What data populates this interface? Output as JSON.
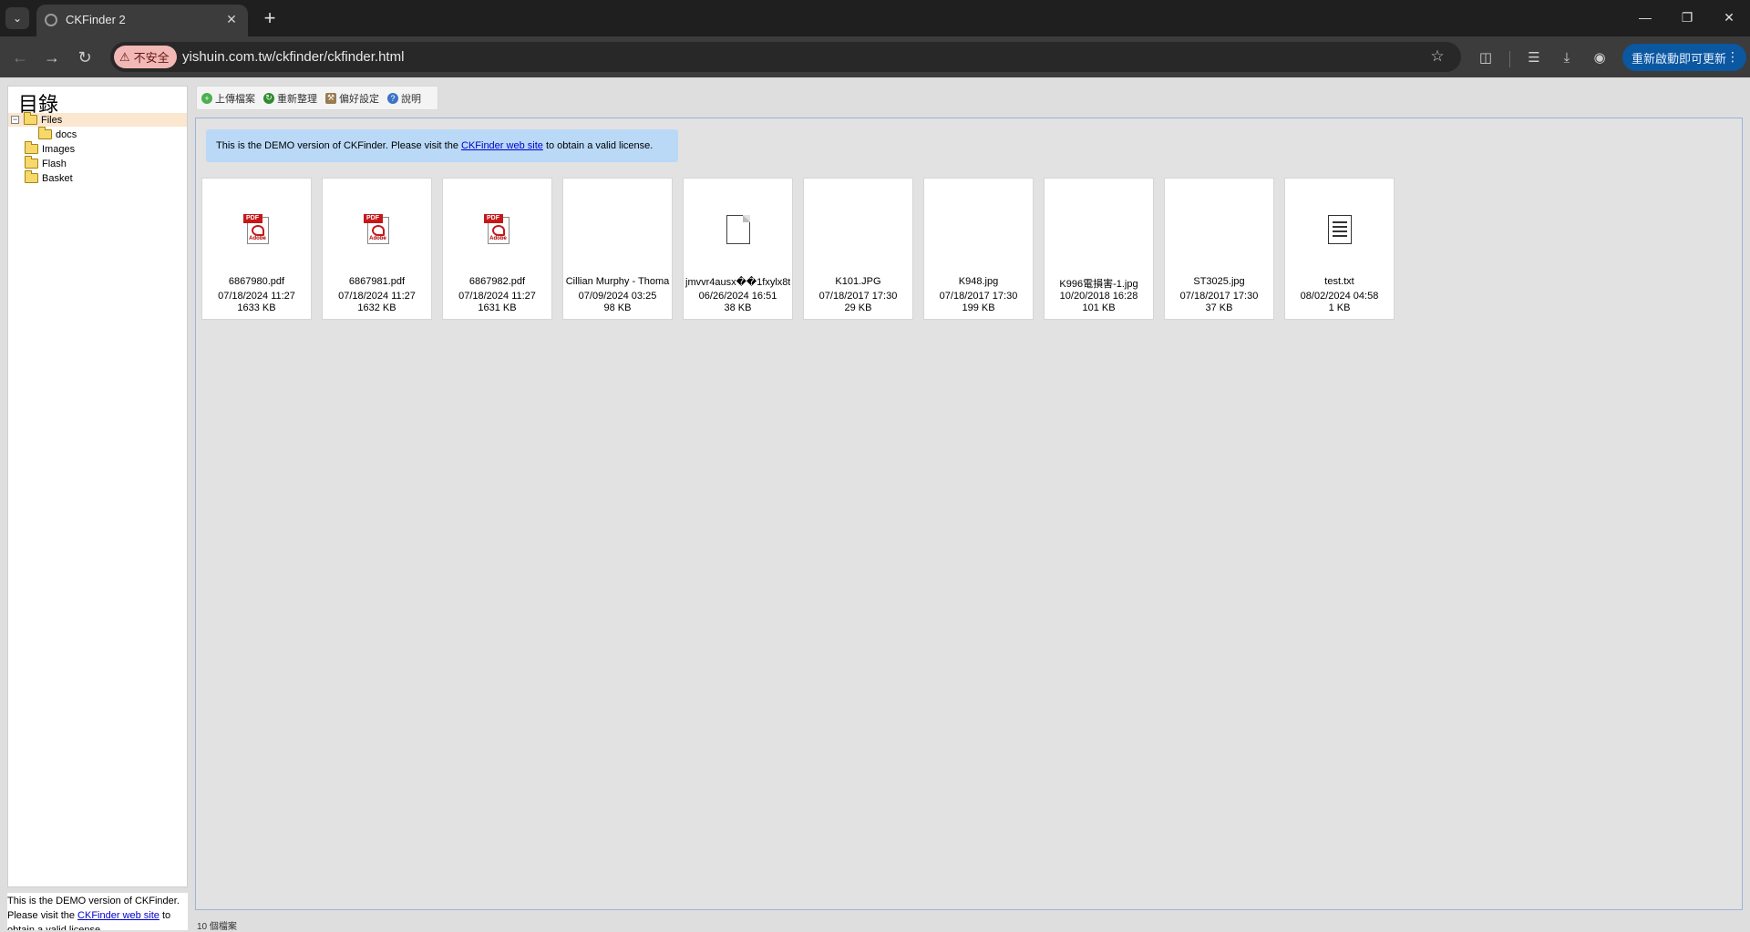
{
  "browser": {
    "tab_title": "CKFinder 2",
    "tab_close": "✕",
    "new_tab": "+",
    "insecure_label": "不安全",
    "url": "yishuin.com.tw/ckfinder/ckfinder.html",
    "update_label": "重新啟動即可更新",
    "update_menu": "⋮"
  },
  "sidebar": {
    "title": "目錄",
    "tree": [
      {
        "label": "Files",
        "level": 0,
        "expanded": true,
        "selected": true
      },
      {
        "label": "docs",
        "level": 1,
        "expanded": false,
        "selected": false
      },
      {
        "label": "Images",
        "level": 0,
        "expanded": false,
        "selected": false
      },
      {
        "label": "Flash",
        "level": 0,
        "expanded": false,
        "selected": false
      },
      {
        "label": "Basket",
        "level": 0,
        "expanded": false,
        "selected": false
      }
    ],
    "footer": {
      "text_before": "This is the DEMO version of CKFinder. Please visit the ",
      "link": "CKFinder web site",
      "text_after": " to obtain a valid license."
    }
  },
  "toolbar": {
    "buttons": [
      {
        "label": "上傳檔案",
        "icon": "upload-icon",
        "color": "#4caf50"
      },
      {
        "label": "重新整理",
        "icon": "refresh-icon",
        "color": "#2e8b2e"
      },
      {
        "label": "偏好設定",
        "icon": "settings-icon",
        "color": "#9a7b4f"
      },
      {
        "label": "說明",
        "icon": "help-icon",
        "color": "#3b73c8"
      }
    ]
  },
  "banner": {
    "text_before": "This is the DEMO version of CKFinder. Please visit the ",
    "link": "CKFinder web site",
    "text_after": " to obtain a valid license.",
    "color": "#b9d9f7"
  },
  "files": [
    {
      "name": "6867980.pdf",
      "date": "07/18/2024 11:27",
      "size": "1633 KB",
      "icon": "pdf"
    },
    {
      "name": "6867981.pdf",
      "date": "07/18/2024 11:27",
      "size": "1632 KB",
      "icon": "pdf"
    },
    {
      "name": "6867982.pdf",
      "date": "07/18/2024 11:27",
      "size": "1631 KB",
      "icon": "pdf"
    },
    {
      "name": "Cillian Murphy - Thoma",
      "date": "07/09/2024 03:25",
      "size": "98 KB",
      "icon": "none"
    },
    {
      "name": "jmvvr4ausx��1fxylx8t",
      "date": "06/26/2024 16:51",
      "size": "38 KB",
      "icon": "blank"
    },
    {
      "name": "K101.JPG",
      "date": "07/18/2017 17:30",
      "size": "29 KB",
      "icon": "none"
    },
    {
      "name": "K948.jpg",
      "date": "07/18/2017 17:30",
      "size": "199 KB",
      "icon": "none"
    },
    {
      "name": "K996電損害-1.jpg",
      "date": "10/20/2018 16:28",
      "size": "101 KB",
      "icon": "none"
    },
    {
      "name": "ST3025.jpg",
      "date": "07/18/2017 17:30",
      "size": "37 KB",
      "icon": "none"
    },
    {
      "name": "test.txt",
      "date": "08/02/2024 04:58",
      "size": "1 KB",
      "icon": "text"
    }
  ],
  "status": "10 個檔案"
}
